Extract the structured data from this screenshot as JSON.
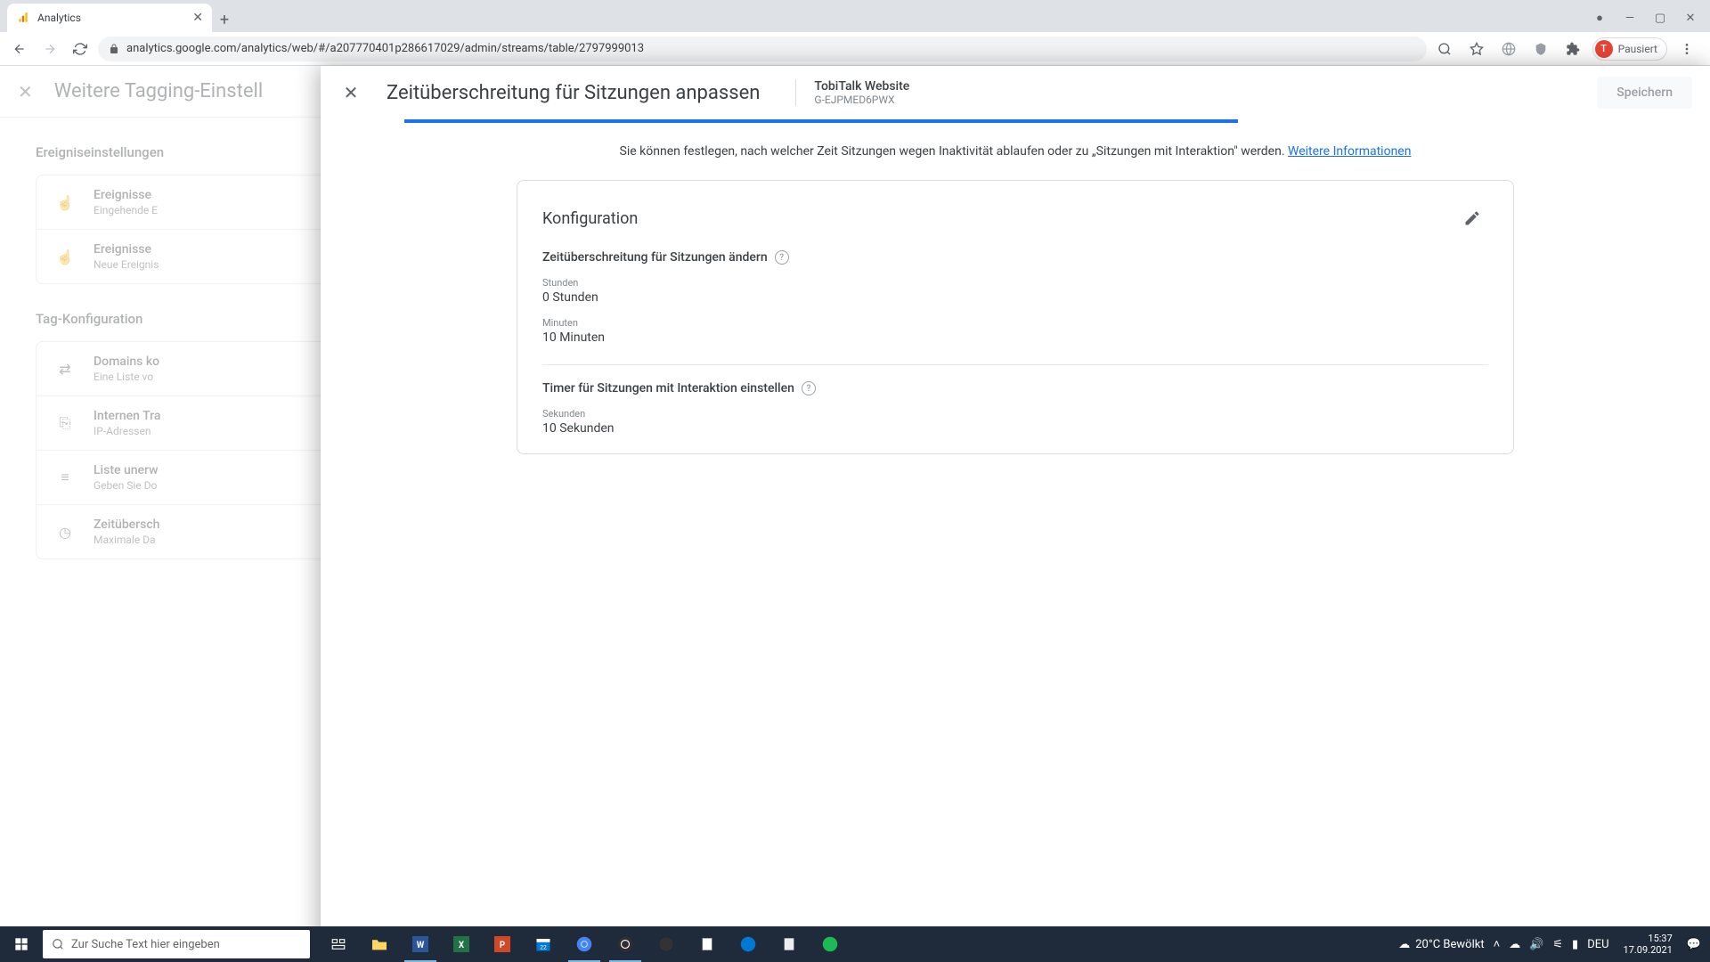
{
  "browser": {
    "tab_title": "Analytics",
    "url": "analytics.google.com/analytics/web/#/a207770401p286617029/admin/streams/table/2797999013",
    "profile_status": "Pausiert",
    "profile_initial": "T"
  },
  "bg_panel": {
    "title": "Weitere Tagging-Einstell",
    "section1": "Ereigniseinstellungen",
    "section2": "Tag-Konfiguration",
    "events": [
      {
        "title": "Ereignisse",
        "sub": "Eingehende E"
      },
      {
        "title": "Ereignisse",
        "sub": "Neue Ereignis"
      }
    ],
    "tags": [
      {
        "title": "Domains ko",
        "sub": "Eine Liste vo"
      },
      {
        "title": "Internen Tra",
        "sub": "IP-Adressen"
      },
      {
        "title": "Liste unerw",
        "sub": "Geben Sie Do"
      },
      {
        "title": "Zeitübersch",
        "sub": "Maximale Da"
      }
    ]
  },
  "modal": {
    "title": "Zeitüberschreitung für Sitzungen anpassen",
    "property_name": "TobiTalk Website",
    "property_id": "G-EJPMED6PWX",
    "save_label": "Speichern",
    "intro_text": "Sie können festlegen, nach welcher Zeit Sitzungen wegen Inaktivität ablaufen oder zu „Sitzungen mit Interaktion\" werden.",
    "intro_link": "Weitere Informationen",
    "config_title": "Konfiguration",
    "section1_title": "Zeitüberschreitung für Sitzungen ändern",
    "field_hours_label": "Stunden",
    "field_hours_value": "0  Stunden",
    "field_minutes_label": "Minuten",
    "field_minutes_value": "10  Minuten",
    "section2_title": "Timer für Sitzungen mit Interaktion einstellen",
    "field_seconds_label": "Sekunden",
    "field_seconds_value": "10  Sekunden"
  },
  "taskbar": {
    "search_placeholder": "Zur Suche Text hier eingeben",
    "weather": "20°C  Bewölkt",
    "lang": "DEU",
    "time": "15:37",
    "date": "17.09.2021"
  }
}
